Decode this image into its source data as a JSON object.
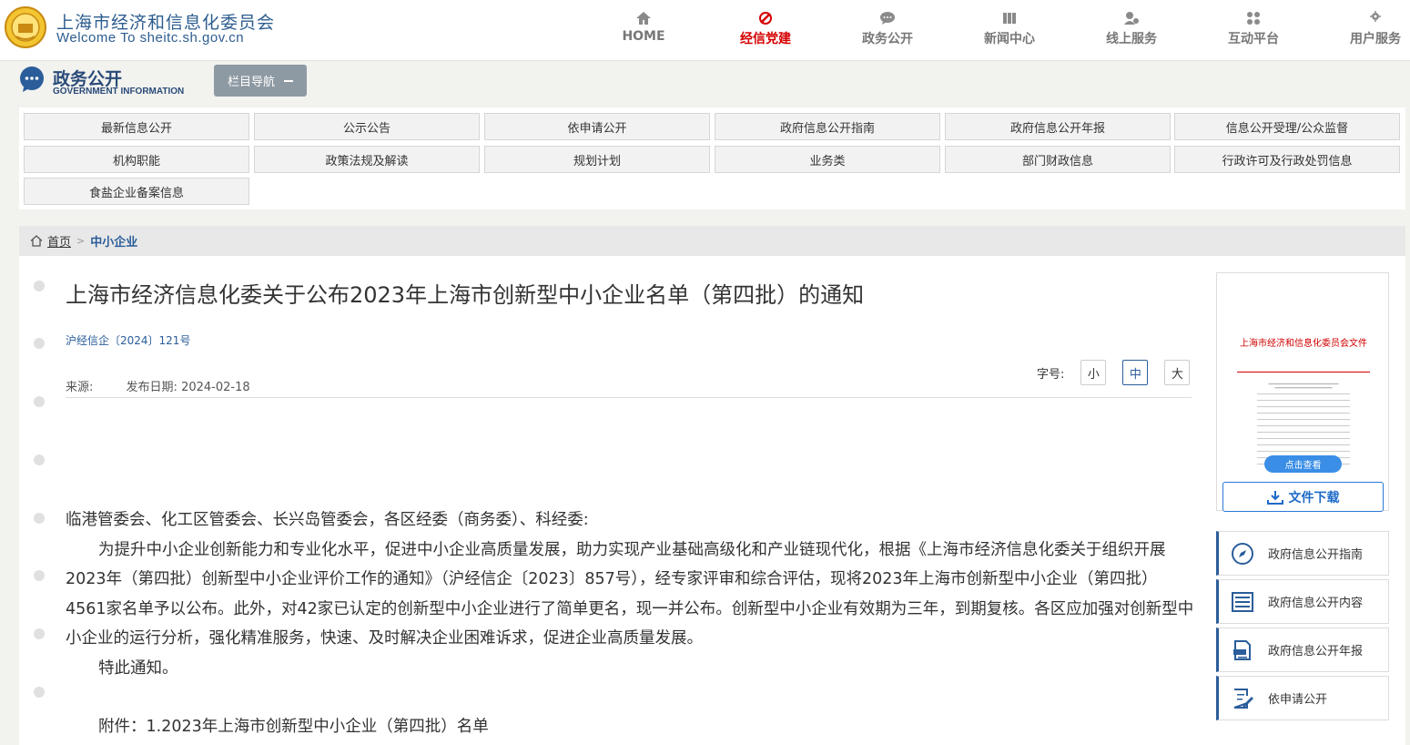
{
  "header": {
    "site_title": "上海市经济和信息化委员会",
    "site_subtitle": "Welcome To sheitc.sh.gov.cn",
    "nav": [
      {
        "label": "HOME",
        "icon": "home-icon"
      },
      {
        "label": "经信党建",
        "icon": "party-emblem-icon",
        "active": true
      },
      {
        "label": "政务公开",
        "icon": "chat-bubble-icon"
      },
      {
        "label": "新闻中心",
        "icon": "newspaper-icon"
      },
      {
        "label": "线上服务",
        "icon": "user-service-icon"
      },
      {
        "label": "互动平台",
        "icon": "interaction-icon"
      },
      {
        "label": "用户服务",
        "icon": "user-gear-icon"
      }
    ],
    "active_color": "#d40000"
  },
  "gov": {
    "title": "政务公开",
    "subtitle": "GOVERNMENT INFORMATION",
    "column_nav_label": "栏目导航"
  },
  "categories": [
    "最新信息公开",
    "公示公告",
    "依申请公开",
    "政府信息公开指南",
    "政府信息公开年报",
    "信息公开受理/公众监督",
    "机构职能",
    "政策法规及解读",
    "规划计划",
    "业务类",
    "部门财政信息",
    "行政许可及行政处罚信息",
    "食盐企业备案信息"
  ],
  "breadcrumb": {
    "home": "首页",
    "sep": ">",
    "current": "中小企业"
  },
  "article": {
    "title": "上海市经济信息化委关于公布2023年上海市创新型中小企业名单（第四批）的通知",
    "doc_number": "沪经信企〔2024〕121号",
    "source_label": "来源:",
    "date_label": "发布日期:",
    "date": "2024-02-18",
    "font_size_label": "字号:",
    "font_sizes": [
      "小",
      "中",
      "大"
    ],
    "selected_font_size": "中",
    "addressee": "临港管委会、化工区管委会、长兴岛管委会，各区经委（商务委）、科经委:",
    "paragraph": "为提升中小企业创新能力和专业化水平，促进中小企业高质量发展，助力实现产业基础高级化和产业链现代化，根据《上海市经济信息化委关于组织开展2023年（第四批）创新型中小企业评价工作的通知》（沪经信企〔2023〕857号），经专家评审和综合评估，现将2023年上海市创新型中小企业（第四批）4561家名单予以公布。此外，对42家已认定的创新型中小企业进行了简单更名，现一并公布。创新型中小企业有效期为三年，到期复核。各区应加强对创新型中小企业的运行分析，强化精准服务，快速、及时解决企业困难诉求，促进企业高质量发展。",
    "closing": "特此通知。",
    "attachment": "附件：1.2023年上海市创新型中小企业（第四批）名单"
  },
  "sidebar": {
    "thumb_header": "上海市经济和信息化委员会文件",
    "thumb_button": "点击查看",
    "download_label": "文件下载",
    "links": [
      {
        "label": "政府信息公开指南",
        "icon": "compass-icon"
      },
      {
        "label": "政府信息公开内容",
        "icon": "list-icon"
      },
      {
        "label": "政府信息公开年报",
        "icon": "report-icon"
      },
      {
        "label": "依申请公开",
        "icon": "edit-form-icon"
      }
    ]
  }
}
